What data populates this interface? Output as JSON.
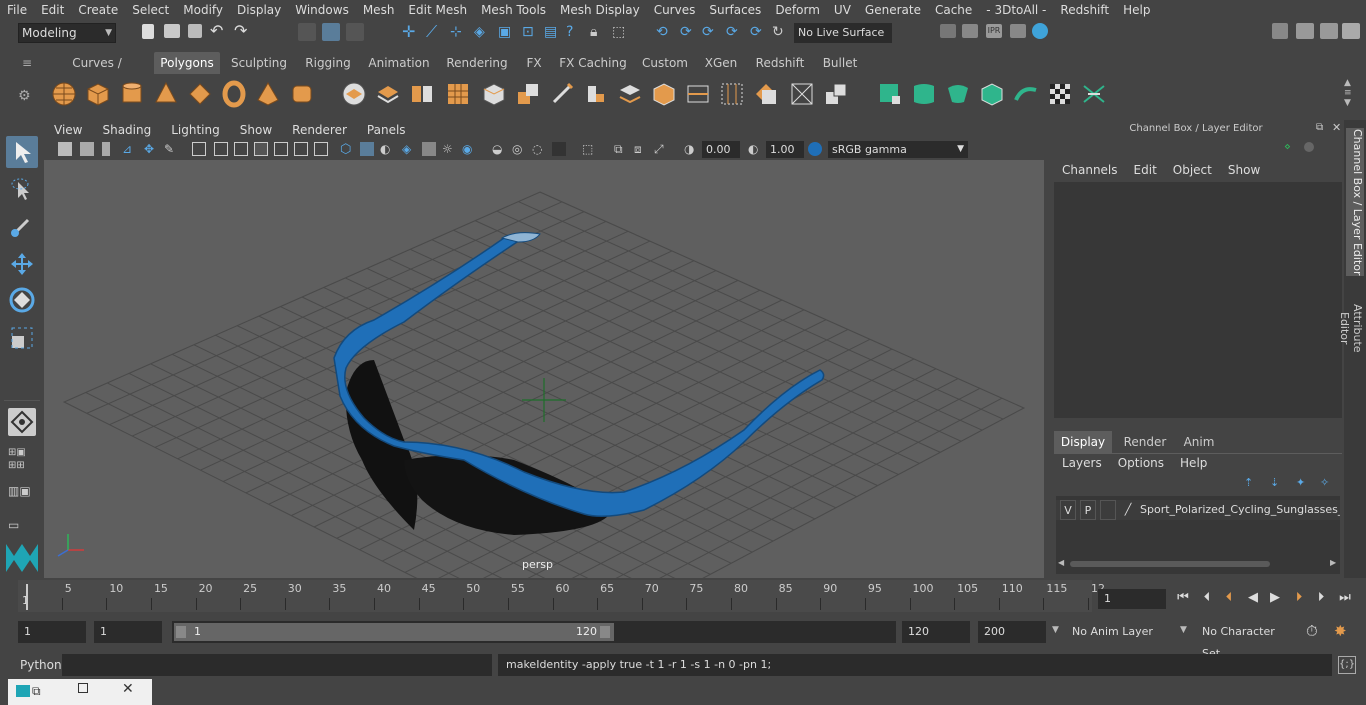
{
  "menubar": {
    "items": [
      "File",
      "Edit",
      "Create",
      "Select",
      "Modify",
      "Display",
      "Windows",
      "Mesh",
      "Edit Mesh",
      "Mesh Tools",
      "Mesh Display",
      "Curves",
      "Surfaces",
      "Deform",
      "UV",
      "Generate",
      "Cache",
      "- 3DtoAll -",
      "Redshift",
      "Help"
    ]
  },
  "statusline": {
    "mode": "Modeling",
    "live_surface": "No Live Surface"
  },
  "shelf": {
    "tabs": [
      "Curves / Surfaces",
      "Polygons",
      "Sculpting",
      "Rigging",
      "Animation",
      "Rendering",
      "FX",
      "FX Caching",
      "Custom",
      "XGen",
      "Redshift",
      "Bullet"
    ],
    "active_tab": "Polygons"
  },
  "panel": {
    "menus": [
      "View",
      "Shading",
      "Lighting",
      "Show",
      "Renderer",
      "Panels"
    ],
    "exposure": "0.00",
    "gamma": "1.00",
    "color_space": "sRGB gamma",
    "camera_label": "persp"
  },
  "channel_box": {
    "title": "Channel Box / Layer Editor",
    "menus": [
      "Channels",
      "Edit",
      "Object",
      "Show"
    ],
    "layer_tabs": [
      "Display",
      "Render",
      "Anim"
    ],
    "active_layer_tab": "Display",
    "layer_menus": [
      "Layers",
      "Options",
      "Help"
    ],
    "layer": {
      "visible": "V",
      "playback": "P",
      "name": "Sport_Polarized_Cycling_Sunglasses_B"
    }
  },
  "side_tabs": [
    "Channel Box / Layer Editor",
    "Attribute Editor"
  ],
  "timeslider": {
    "labels": [
      "5",
      "10",
      "15",
      "20",
      "25",
      "30",
      "35",
      "40",
      "45",
      "50",
      "55",
      "60",
      "65",
      "70",
      "75",
      "80",
      "85",
      "90",
      "95",
      "100",
      "105",
      "110",
      "115",
      "12"
    ],
    "first_frame": "1",
    "current_frame": "1"
  },
  "range": {
    "start": "1",
    "playback_start": "1",
    "handle_start": "1",
    "handle_end": "120",
    "playback_end": "120",
    "end": "200",
    "anim_layer": "No Anim Layer",
    "character_set": "No Character Set"
  },
  "command_line": {
    "language": "Python",
    "output": "makeIdentity -apply true -t 1 -r 1 -s 1 -n 0 -pn 1;"
  },
  "colors": {
    "accent_blue": "#1f6fb8",
    "shelf_orange": "#e39a4c",
    "shelf_green": "#2fb58c"
  }
}
